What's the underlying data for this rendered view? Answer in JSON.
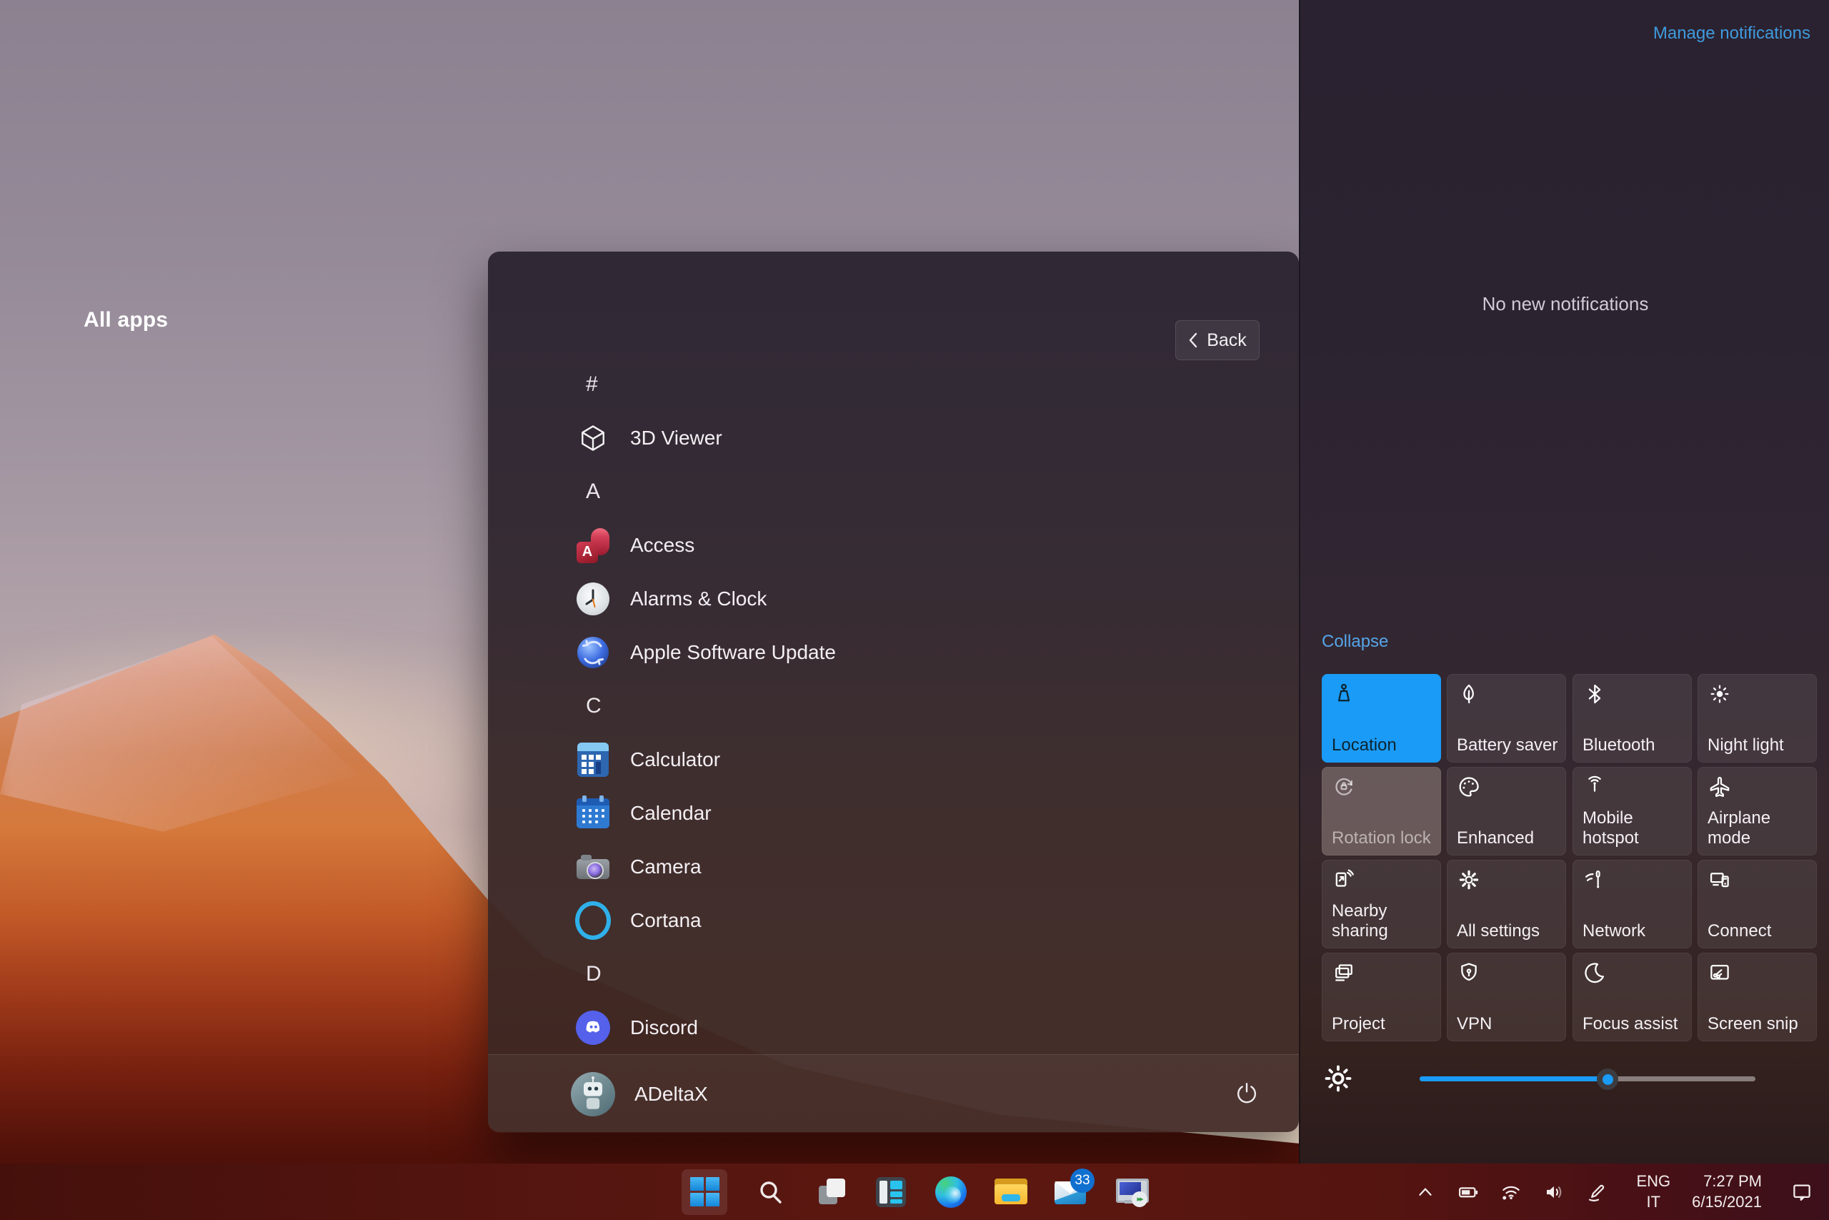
{
  "start_menu": {
    "title": "All apps",
    "back_label": "Back",
    "rows": [
      {
        "type": "letter",
        "label": "#"
      },
      {
        "type": "app",
        "label": "3D Viewer",
        "icon": "3d-viewer"
      },
      {
        "type": "letter",
        "label": "A"
      },
      {
        "type": "app",
        "label": "Access",
        "icon": "access"
      },
      {
        "type": "app",
        "label": "Alarms & Clock",
        "icon": "alarms-clock"
      },
      {
        "type": "app",
        "label": "Apple Software Update",
        "icon": "apple-software-update"
      },
      {
        "type": "letter",
        "label": "C"
      },
      {
        "type": "app",
        "label": "Calculator",
        "icon": "calculator"
      },
      {
        "type": "app",
        "label": "Calendar",
        "icon": "calendar"
      },
      {
        "type": "app",
        "label": "Camera",
        "icon": "camera"
      },
      {
        "type": "app",
        "label": "Cortana",
        "icon": "cortana"
      },
      {
        "type": "letter",
        "label": "D"
      },
      {
        "type": "app",
        "label": "Discord",
        "icon": "discord"
      }
    ],
    "user": {
      "name": "ADeltaX",
      "power_icon": "power-icon"
    }
  },
  "action_center": {
    "manage_link": "Manage notifications",
    "empty_message": "No new notifications",
    "collapse_link": "Collapse",
    "tiles": [
      {
        "label": "Location",
        "icon": "location-icon",
        "state": "on"
      },
      {
        "label": "Battery saver",
        "icon": "leaf-icon",
        "state": "off"
      },
      {
        "label": "Bluetooth",
        "icon": "bluetooth-icon",
        "state": "off"
      },
      {
        "label": "Night light",
        "icon": "sun-icon",
        "state": "off"
      },
      {
        "label": "Rotation lock",
        "icon": "rotation-lock-icon",
        "state": "disabled"
      },
      {
        "label": "Enhanced",
        "icon": "palette-icon",
        "state": "off"
      },
      {
        "label": "Mobile hotspot",
        "icon": "hotspot-icon",
        "state": "off"
      },
      {
        "label": "Airplane mode",
        "icon": "airplane-icon",
        "state": "off"
      },
      {
        "label": "Nearby sharing",
        "icon": "share-icon",
        "state": "off"
      },
      {
        "label": "All settings",
        "icon": "gear-icon",
        "state": "off"
      },
      {
        "label": "Network",
        "icon": "network-icon",
        "state": "off"
      },
      {
        "label": "Connect",
        "icon": "connect-icon",
        "state": "off"
      },
      {
        "label": "Project",
        "icon": "project-icon",
        "state": "off"
      },
      {
        "label": "VPN",
        "icon": "shield-icon",
        "state": "off"
      },
      {
        "label": "Focus assist",
        "icon": "moon-icon",
        "state": "off"
      },
      {
        "label": "Screen snip",
        "icon": "snip-icon",
        "state": "off"
      }
    ],
    "brightness_percent": 56
  },
  "taskbar": {
    "icons": [
      "start",
      "search",
      "task-view",
      "widgets",
      "edge",
      "file-explorer",
      "mail",
      "remote-desktop"
    ],
    "mail_badge": "33",
    "tray_icons": [
      "hidden-icons-chevron",
      "battery",
      "wifi",
      "volume",
      "pen"
    ],
    "tray": {
      "language_line1": "ENG",
      "language_line2": "IT",
      "time": "7:27 PM",
      "date": "6/15/2021"
    }
  },
  "colors": {
    "accent_blue": "#1a9bf7",
    "link_blue": "#3f9ade",
    "taskbar_maroon": "#551510",
    "menu_dark": "#2c2532"
  }
}
